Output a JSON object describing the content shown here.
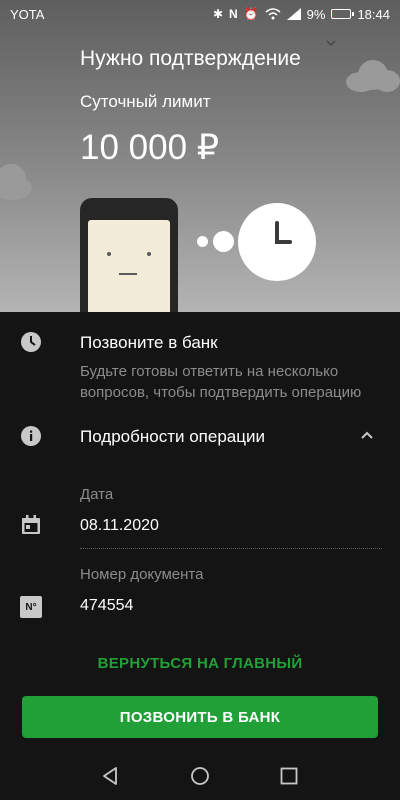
{
  "status_bar": {
    "carrier": "YOTA",
    "battery_percent": "9%",
    "battery_level": 0.09,
    "time": "18:44",
    "icons": [
      "bluetooth-icon",
      "nfc-icon",
      "alarm-icon",
      "wifi-icon",
      "signal-icon",
      "battery-icon"
    ]
  },
  "hero": {
    "title": "Нужно подтверждение",
    "limit_label": "Суточный лимит",
    "limit_value": "10 000 ₽",
    "illustration": [
      "cloud",
      "phone-face",
      "clock"
    ]
  },
  "call_section": {
    "icon": "clock-icon",
    "title": "Позвоните в банк",
    "description": "Будьте готовы ответить на несколько вопросов, чтобы подтвердить операцию"
  },
  "details": {
    "icon": "info-icon",
    "title": "Подробности операции",
    "expanded": true,
    "fields": [
      {
        "icon": "calendar-icon",
        "label": "Дата",
        "value": "08.11.2020"
      },
      {
        "icon": "number-sign-icon",
        "icon_text": "N°",
        "label": "Номер документа",
        "value": "474554"
      }
    ]
  },
  "actions": {
    "back_label": "ВЕРНУТЬСЯ НА ГЛАВНЫЙ",
    "call_label": "ПОЗВОНИТЬ В БАНК"
  },
  "nav": [
    "back-icon",
    "home-icon",
    "recents-icon"
  ],
  "colors": {
    "accent": "#21a038",
    "background": "#141414",
    "muted_text": "#8c8c8c",
    "battery_low": "#e53935"
  }
}
